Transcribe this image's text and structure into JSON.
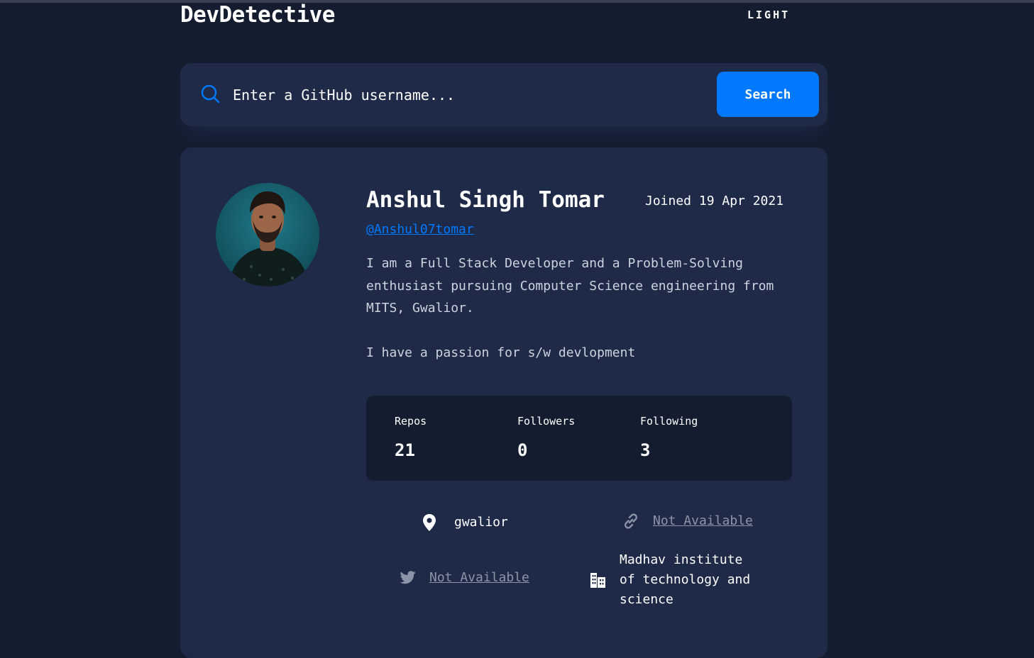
{
  "app": {
    "title": "DevDetective",
    "theme_toggle": "LIGHT"
  },
  "search": {
    "placeholder": "Enter a GitHub username...",
    "button_label": "Search"
  },
  "profile": {
    "name": "Anshul Singh Tomar",
    "joined": "Joined 19 Apr 2021",
    "username": "@Anshul07tomar",
    "bio_lines": [
      "I am a Full Stack Developer and a Problem-Solving enthusiast pursuing Computer Science engineering from MITS, Gwalior.",
      "I have a passion for s/w devlopment"
    ],
    "stats": [
      {
        "label": "Repos",
        "value": "21"
      },
      {
        "label": "Followers",
        "value": "0"
      },
      {
        "label": "Following",
        "value": "3"
      }
    ],
    "info": {
      "location": "gwalior",
      "website": "Not Available",
      "twitter": "Not Available",
      "company": "Madhav institute of technology and science"
    }
  },
  "icons": {
    "search": "search-icon",
    "location": "location-pin-icon",
    "website": "link-icon",
    "twitter": "twitter-icon",
    "company": "building-icon"
  },
  "colors": {
    "background": "#141d2f",
    "card": "#1e2a47",
    "accent": "#0079ff",
    "muted": "#8c95a8"
  }
}
